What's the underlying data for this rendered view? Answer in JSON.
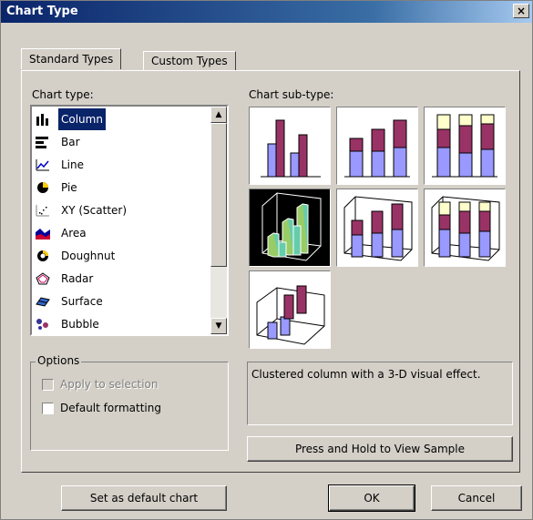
{
  "window": {
    "title": "Chart Type",
    "close_symbol": "×"
  },
  "tabs": [
    {
      "label": "Standard Types",
      "active": true
    },
    {
      "label": "Custom Types",
      "active": false
    }
  ],
  "chart_type": {
    "label": "Chart type:",
    "items": [
      {
        "label": "Column",
        "icon": "column-chart-icon",
        "selected": true
      },
      {
        "label": "Bar",
        "icon": "bar-chart-icon"
      },
      {
        "label": "Line",
        "icon": "line-chart-icon"
      },
      {
        "label": "Pie",
        "icon": "pie-chart-icon"
      },
      {
        "label": "XY (Scatter)",
        "icon": "scatter-chart-icon"
      },
      {
        "label": "Area",
        "icon": "area-chart-icon"
      },
      {
        "label": "Doughnut",
        "icon": "doughnut-chart-icon"
      },
      {
        "label": "Radar",
        "icon": "radar-chart-icon"
      },
      {
        "label": "Surface",
        "icon": "surface-chart-icon"
      },
      {
        "label": "Bubble",
        "icon": "bubble-chart-icon"
      }
    ]
  },
  "subtype": {
    "label": "Chart sub-type:",
    "selected_index": 3
  },
  "options": {
    "label": "Options",
    "apply_to_selection": "Apply to selection",
    "default_formatting": "Default formatting"
  },
  "description": "Clustered column with a 3-D visual effect.",
  "buttons": {
    "press_hold": "Press and Hold to View Sample",
    "set_default": "Set as default chart",
    "ok": "OK",
    "cancel": "Cancel"
  },
  "colors": {
    "series1": "#9999ff",
    "series2": "#993366",
    "series3": "#ffffcc",
    "selected_green": "#99cc66",
    "selected_teal": "#66ccaa"
  }
}
